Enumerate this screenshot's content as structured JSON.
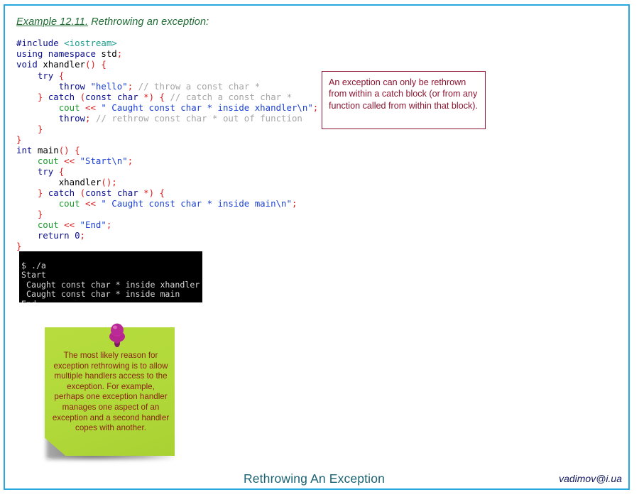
{
  "slide": {
    "frame_color": "#26a8de",
    "background": "#ffffff"
  },
  "heading": {
    "example_label": "Example 12.11.",
    "title": " Rethrowing an exception:",
    "color": "#1f6b33"
  },
  "code": {
    "language": "C++",
    "lines": [
      "#include <iostream>",
      "using namespace std;",
      "void xhandler() {",
      "    try {",
      "        throw \"hello\"; // throw a const char *",
      "    } catch (const char *) { // catch a const char *",
      "        cout << \" Caught const char * inside xhandler\\n\";",
      "        throw; // rethrow const char * out of function",
      "    }",
      "}",
      "int main() {",
      "    cout << \"Start\\n\";",
      "    try {",
      "        xhandler();",
      "    } catch (const char *) {",
      "        cout << \" Caught const char * inside main\\n\";",
      "    }",
      "    cout << \"End\";",
      "    return 0;",
      "}"
    ],
    "colors": {
      "keyword": "#0b0f8f",
      "header": "#1a9c8a",
      "string": "#1a3fd4",
      "comment": "#a6a6a6",
      "punctuation": "#e01b1b",
      "stream": "#1f9b2e",
      "identifier": "#000000"
    }
  },
  "callout": {
    "text": "An exception can only be rethrown from within a catch block (or from any function called from within that block).",
    "border_color": "#8c1430",
    "text_color": "#8c1430"
  },
  "terminal": {
    "prompt_line": "$ ./a",
    "lines": [
      "$ ./a",
      "Start",
      " Caught const char * inside xhandler",
      " Caught const char * inside main",
      "End"
    ],
    "background": "#000000",
    "text_color": "#d8d8d8"
  },
  "sticky_note": {
    "text": "The most likely reason for exception rethrowing is to allow multiple handlers access to the exception. For example, perhaps one exception handler manages one aspect of an exception and a second handler copes with another.",
    "paper_color": "#b2d93a",
    "text_color": "#8a2412",
    "pin_color": "#b5278f"
  },
  "footer": {
    "title": "Rethrowing An Exception",
    "title_color": "#1b6372",
    "email": "vadimov@i.ua",
    "email_color": "#131a5c"
  }
}
